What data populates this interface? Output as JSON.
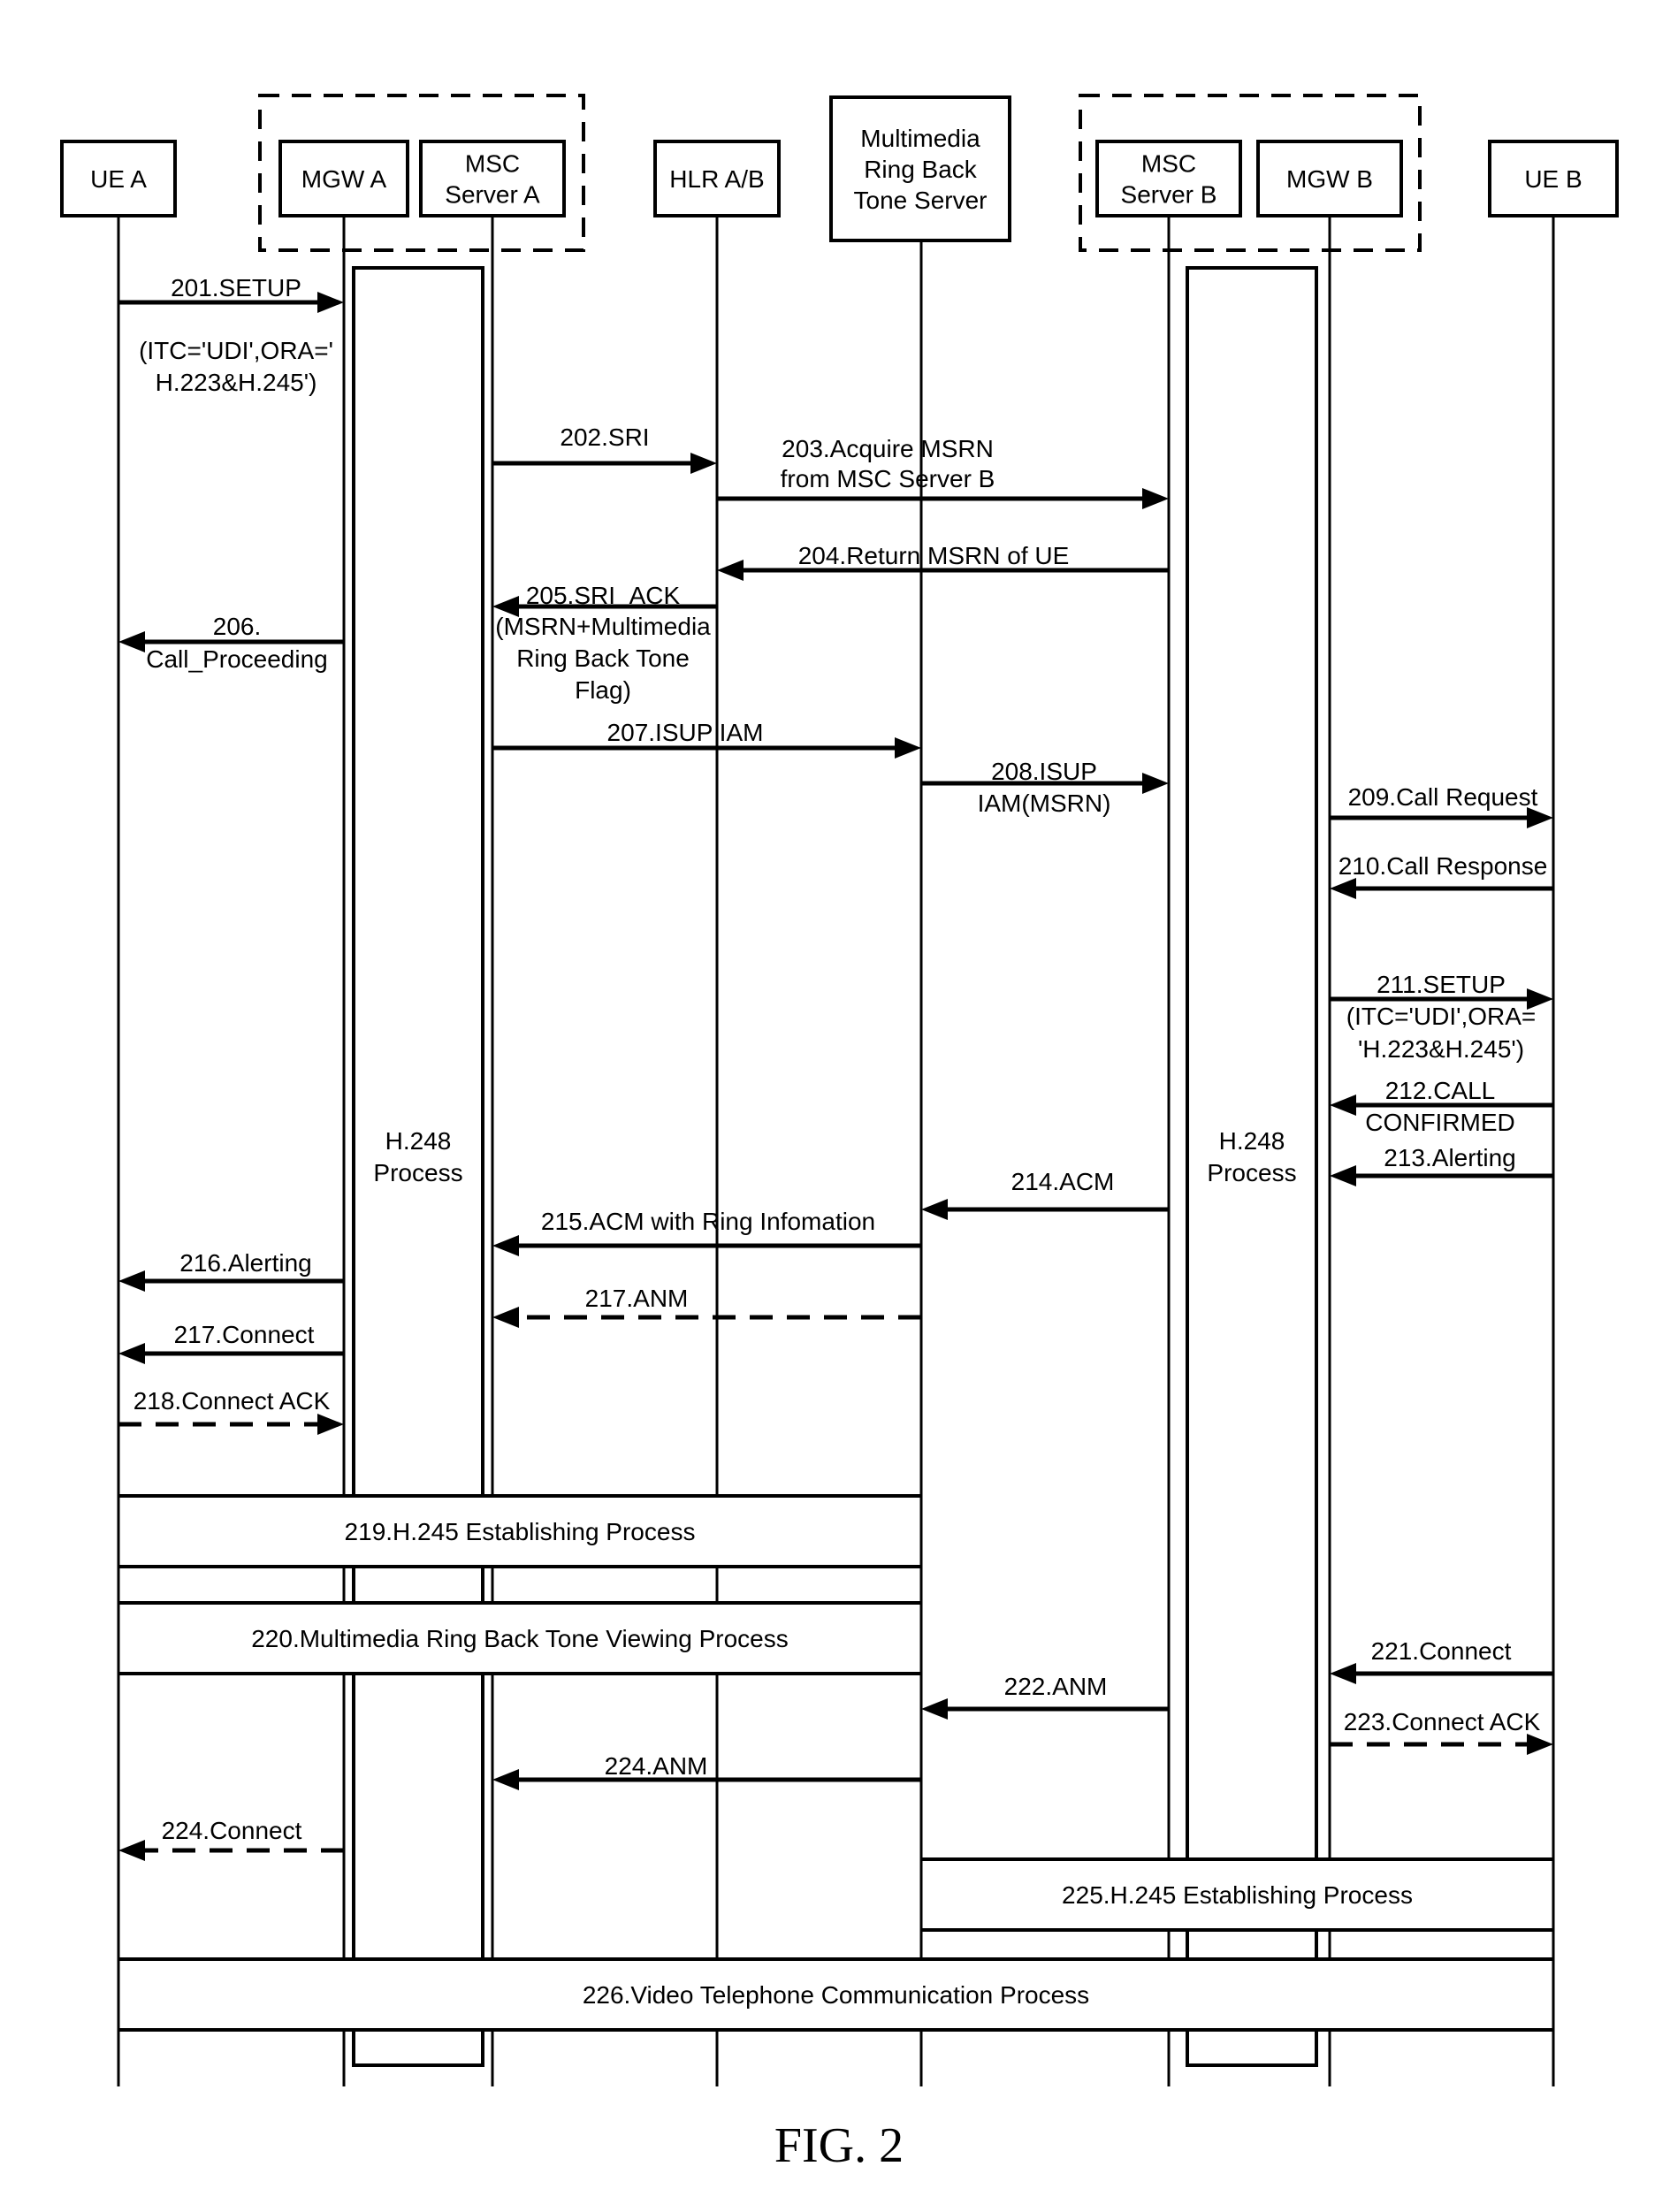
{
  "figure_label": "FIG. 2",
  "entities": [
    {
      "id": "ue_a",
      "lines": [
        "UE A"
      ]
    },
    {
      "id": "mgw_a",
      "lines": [
        "MGW A"
      ]
    },
    {
      "id": "msc_a",
      "lines": [
        "MSC",
        "Server A"
      ]
    },
    {
      "id": "hlr",
      "lines": [
        "HLR A/B"
      ]
    },
    {
      "id": "mrbt",
      "lines": [
        "Multimedia",
        "Ring Back",
        "Tone Server"
      ]
    },
    {
      "id": "msc_b",
      "lines": [
        "MSC",
        "Server B"
      ]
    },
    {
      "id": "mgw_b",
      "lines": [
        "MGW B"
      ]
    },
    {
      "id": "ue_b",
      "lines": [
        "UE B"
      ]
    }
  ],
  "groups": [
    {
      "name": "network-a-group",
      "members": [
        "mgw_a",
        "msc_a"
      ]
    },
    {
      "name": "network-b-group",
      "members": [
        "msc_b",
        "mgw_b"
      ]
    }
  ],
  "h248_processes": [
    {
      "owner": "mgw_a",
      "lines": [
        "H.248",
        "Process"
      ]
    },
    {
      "owner": "mgw_b",
      "lines": [
        "H.248",
        "Process"
      ]
    }
  ],
  "messages": [
    {
      "id": "201",
      "from": "ue_a",
      "to": "mgw_a",
      "style": "solid",
      "lines": [
        "201.SETUP",
        "(ITC='UDI',ORA='",
        "H.223&H.245')"
      ]
    },
    {
      "id": "202",
      "from": "msc_a",
      "to": "hlr",
      "style": "solid",
      "lines": [
        "202.SRI"
      ]
    },
    {
      "id": "203",
      "from": "hlr",
      "to": "msc_b",
      "style": "solid",
      "lines": [
        "203.Acquire MSRN",
        "from MSC Server B"
      ]
    },
    {
      "id": "204",
      "from": "msc_b",
      "to": "hlr",
      "style": "solid",
      "lines": [
        "204.Return MSRN of UE"
      ]
    },
    {
      "id": "205",
      "from": "hlr",
      "to": "msc_a",
      "style": "solid",
      "lines": [
        "205.SRI_ACK",
        "(MSRN+Multimedia",
        "Ring Back Tone",
        "Flag)"
      ]
    },
    {
      "id": "206",
      "from": "mgw_a",
      "to": "ue_a",
      "style": "solid",
      "lines": [
        "206.",
        "Call_Proceeding"
      ]
    },
    {
      "id": "207",
      "from": "msc_a",
      "to": "mrbt",
      "style": "solid",
      "lines": [
        "207.ISUP  IAM"
      ]
    },
    {
      "id": "208",
      "from": "mrbt",
      "to": "msc_b",
      "style": "solid",
      "lines": [
        "208.ISUP",
        "IAM(MSRN)"
      ]
    },
    {
      "id": "209",
      "from": "mgw_b",
      "to": "ue_b",
      "style": "solid",
      "lines": [
        "209.Call Request"
      ]
    },
    {
      "id": "210",
      "from": "ue_b",
      "to": "mgw_b",
      "style": "solid",
      "lines": [
        "210.Call Response"
      ]
    },
    {
      "id": "211",
      "from": "mgw_b",
      "to": "ue_b",
      "style": "solid",
      "lines": [
        "211.SETUP",
        "(ITC='UDI',ORA=",
        "'H.223&H.245')"
      ]
    },
    {
      "id": "212",
      "from": "ue_b",
      "to": "mgw_b",
      "style": "solid",
      "lines": [
        "212.CALL",
        "CONFIRMED"
      ]
    },
    {
      "id": "213",
      "from": "ue_b",
      "to": "mgw_b",
      "style": "solid",
      "lines": [
        "213.Alerting"
      ]
    },
    {
      "id": "214",
      "from": "msc_b",
      "to": "mrbt",
      "style": "solid",
      "lines": [
        "214.ACM"
      ]
    },
    {
      "id": "215",
      "from": "mrbt",
      "to": "msc_a",
      "style": "solid",
      "lines": [
        "215.ACM with Ring Infomation"
      ]
    },
    {
      "id": "216",
      "from": "mgw_a",
      "to": "ue_a",
      "style": "solid",
      "lines": [
        "216.Alerting"
      ]
    },
    {
      "id": "217a",
      "from": "mrbt",
      "to": "msc_a",
      "style": "dashed",
      "lines": [
        "217.ANM"
      ]
    },
    {
      "id": "217b",
      "from": "mgw_a",
      "to": "ue_a",
      "style": "solid",
      "lines": [
        "217.Connect"
      ]
    },
    {
      "id": "218",
      "from": "ue_a",
      "to": "mgw_a",
      "style": "dashed",
      "lines": [
        "218.Connect ACK"
      ]
    },
    {
      "id": "221",
      "from": "ue_b",
      "to": "mgw_b",
      "style": "solid",
      "lines": [
        "221.Connect"
      ]
    },
    {
      "id": "222",
      "from": "msc_b",
      "to": "mrbt",
      "style": "solid",
      "lines": [
        "222.ANM"
      ]
    },
    {
      "id": "223",
      "from": "mgw_b",
      "to": "ue_b",
      "style": "dashed",
      "lines": [
        "223.Connect ACK"
      ]
    },
    {
      "id": "224a",
      "from": "mrbt",
      "to": "msc_a",
      "style": "solid",
      "lines": [
        "224.ANM"
      ]
    },
    {
      "id": "224b",
      "from": "mgw_a",
      "to": "ue_a",
      "style": "dashed",
      "lines": [
        "224.Connect"
      ]
    }
  ],
  "processes": [
    {
      "id": "219",
      "from": "ue_a",
      "to": "mrbt",
      "label": "219.H.245 Establishing Process"
    },
    {
      "id": "220",
      "from": "ue_a",
      "to": "mrbt",
      "label": "220.Multimedia Ring Back Tone Viewing Process"
    },
    {
      "id": "225",
      "from": "mrbt",
      "to": "ue_b",
      "label": "225.H.245 Establishing Process"
    },
    {
      "id": "226",
      "from": "ue_a",
      "to": "ue_b",
      "label": "226.Video Telephone Communication Process"
    }
  ]
}
